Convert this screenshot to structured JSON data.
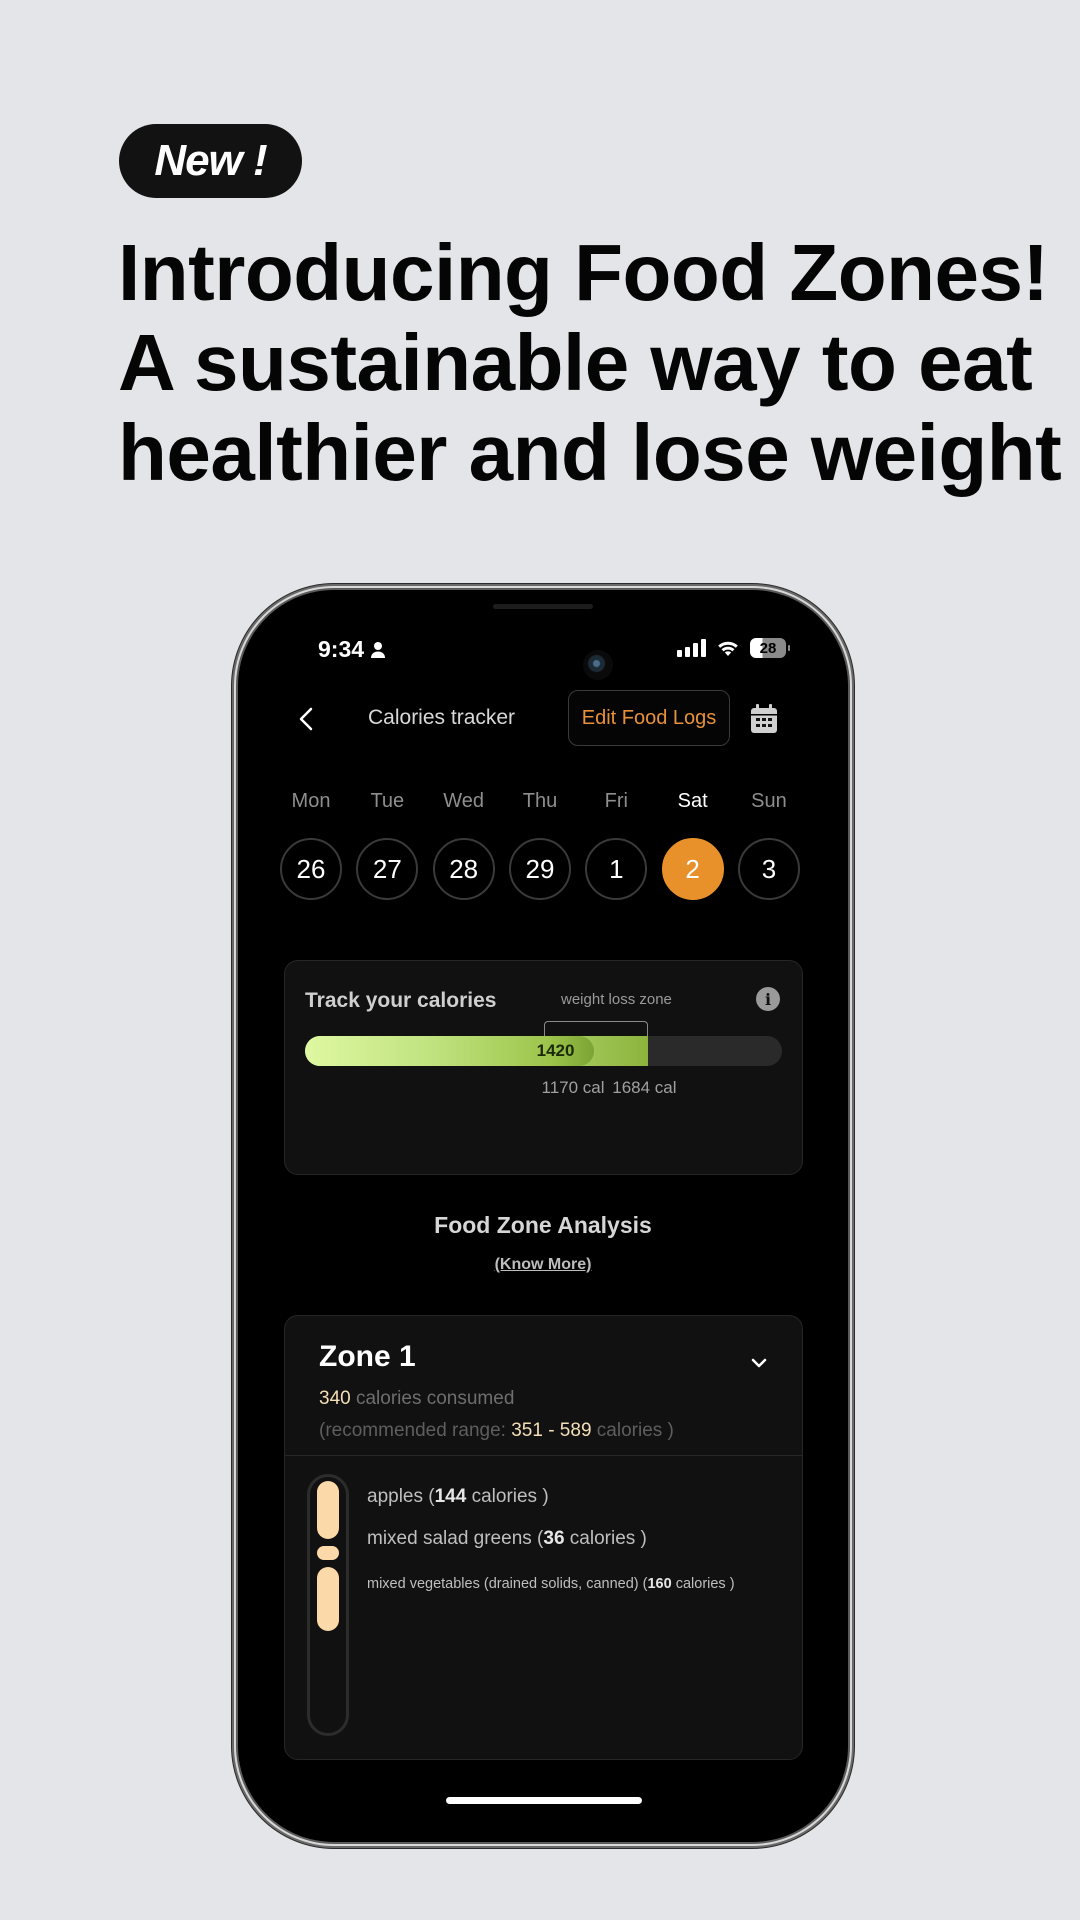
{
  "promo": {
    "badge": "New !",
    "headline": [
      "Introducing Food Zones!",
      "A sustainable way to eat",
      "healthier and lose weight"
    ]
  },
  "status_bar": {
    "time": "9:34",
    "person_icon": "person-icon",
    "signal_icon": "cellular-signal-icon",
    "wifi_icon": "wifi-icon",
    "battery_level": "28"
  },
  "nav": {
    "back_icon": "chevron-left-icon",
    "title": "Calories tracker",
    "edit_button": "Edit Food Logs",
    "calendar_icon": "calendar-icon"
  },
  "week": {
    "days": [
      {
        "label": "Mon",
        "date": "26",
        "selected": false
      },
      {
        "label": "Tue",
        "date": "27",
        "selected": false
      },
      {
        "label": "Wed",
        "date": "28",
        "selected": false
      },
      {
        "label": "Thu",
        "date": "29",
        "selected": false
      },
      {
        "label": "Fri",
        "date": "1",
        "selected": false
      },
      {
        "label": "Sat",
        "date": "2",
        "selected": true
      },
      {
        "label": "Sun",
        "date": "3",
        "selected": false
      }
    ],
    "accent_color": "#e8912b"
  },
  "tracker": {
    "title": "Track your calories",
    "zone_label": "weight loss zone",
    "info_icon": "info-icon",
    "consumed": "1420",
    "zone_min": "1170 cal",
    "zone_max": "1684 cal",
    "consumed_value": 1420,
    "zone_min_value": 1170,
    "zone_max_value": 1684,
    "scale_max_value": 2340
  },
  "analysis": {
    "title": "Food Zone Analysis",
    "link": "(Know More)"
  },
  "zone": {
    "title": "Zone 1",
    "consumed": "340",
    "consumed_suffix": " calories consumed",
    "range_prefix": "(recommended range: ",
    "range": "351 - 589",
    "range_suffix": " calories )",
    "chevron_icon": "chevron-down-icon",
    "segment_color": "#fcd9a8",
    "foods": [
      {
        "name": "apples (",
        "calories": "144",
        "suffix": " calories )",
        "cal_value": 144
      },
      {
        "name": "mixed salad greens (",
        "calories": "36",
        "suffix": " calories )",
        "cal_value": 36
      },
      {
        "name": "mixed vegetables (drained solids, canned) (",
        "calories": "160",
        "suffix": " calories )",
        "cal_value": 160
      }
    ]
  }
}
